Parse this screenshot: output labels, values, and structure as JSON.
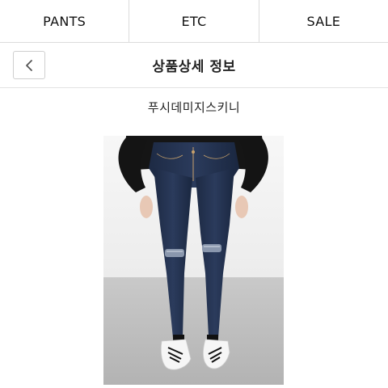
{
  "nav": {
    "tabs": [
      {
        "label": "PANTS"
      },
      {
        "label": "ETC"
      },
      {
        "label": "SALE"
      }
    ]
  },
  "header": {
    "title": "상품상세 정보",
    "back_icon": "chevron-left-icon"
  },
  "product": {
    "name": "푸시데미지스키니",
    "image": "product-photo-skinny-jeans"
  }
}
